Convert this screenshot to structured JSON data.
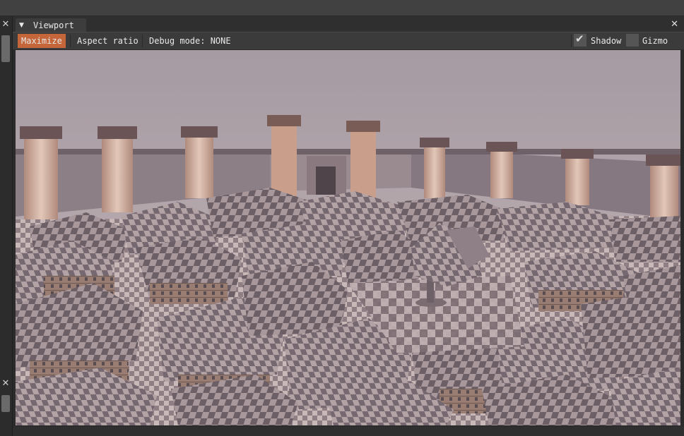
{
  "window": {
    "tab_title": "Viewport",
    "close_glyph": "✕",
    "tab_arrow_glyph": "▼"
  },
  "toolbar": {
    "maximize_label": "Maximize",
    "aspect_ratio_label": "Aspect ratio",
    "debug_mode_label": "Debug mode: NONE",
    "shadow": {
      "label": "Shadow",
      "checked": true,
      "check_glyph": "✔"
    },
    "gizmo": {
      "label": "Gizmo",
      "checked": false
    }
  },
  "left_panel": {
    "close_glyph": "✕"
  },
  "colors": {
    "accent": "#c4663a",
    "window_bg": "#2b2b2b",
    "toolbar_bg": "#3b3b3b",
    "sky_top": "#a89aa3",
    "sky_bottom": "#c2b4b5"
  },
  "icons": {
    "tab_menu": "triangle-down-icon",
    "close": "close-icon",
    "checkbox": "checkmark-icon"
  },
  "viewport_scene": {
    "description_visible": false
  }
}
